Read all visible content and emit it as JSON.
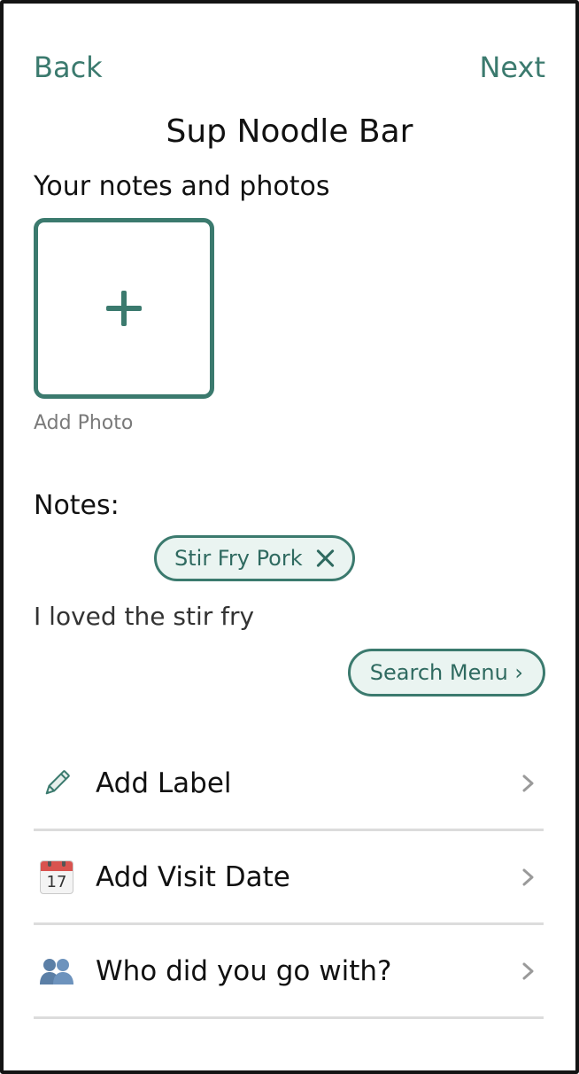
{
  "nav": {
    "back_label": "Back",
    "next_label": "Next"
  },
  "header": {
    "title": "Sup Noodle Bar"
  },
  "photos": {
    "heading": "Your notes and photos",
    "add_photo_label": "Add Photo"
  },
  "notes": {
    "label": "Notes:",
    "tag_label": "Stir Fry Pork",
    "text": "I loved the stir fry",
    "search_menu_label": "Search Menu ›"
  },
  "rows": [
    {
      "label": "Add Label",
      "icon": "pencil-icon"
    },
    {
      "label": "Add Visit Date",
      "icon": "calendar-icon",
      "icon_text": "17"
    },
    {
      "label": "Who did you go with?",
      "icon": "people-icon"
    }
  ],
  "colors": {
    "accent": "#3b7a6e",
    "chip_fill": "#eaf4f1",
    "divider": "#dcdcdc",
    "chevron": "#9a9a9a"
  }
}
